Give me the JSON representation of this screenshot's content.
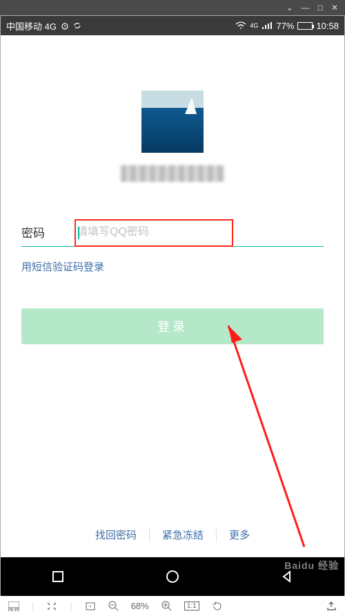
{
  "window": {
    "minimize": "—",
    "maximize": "□",
    "close": "✕",
    "dropdown": "⌄"
  },
  "status": {
    "carrier": "中国移动 4G",
    "network_badge": "4G",
    "battery_percent": "77%",
    "time": "10:58"
  },
  "form": {
    "password_label": "密码",
    "password_placeholder": "请填写QQ密码",
    "sms_login": "用短信验证码登录",
    "login_button": "登录"
  },
  "bottom_links": {
    "find_password": "找回密码",
    "freeze": "紧急冻结",
    "more": "更多"
  },
  "toolbar": {
    "zoom_percent": "68%",
    "ratio": "1:1"
  },
  "watermark": "Baidu 经验"
}
